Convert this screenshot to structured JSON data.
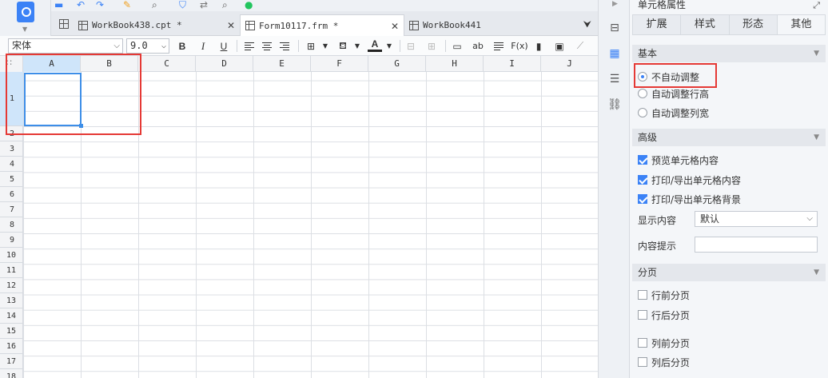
{
  "tabs": [
    {
      "label": "WorkBook438.cpt *",
      "active": false
    },
    {
      "label": "Form10117.frm *",
      "active": true
    },
    {
      "label": "WorkBook441",
      "active": false
    }
  ],
  "format_toolbar": {
    "font_name": "宋体",
    "font_size": "9.0",
    "bold_label": "B",
    "italic_label": "I",
    "underline_label": "U",
    "font_color_label": "A",
    "text_tool_label": "ab",
    "formula_label": "F(x)"
  },
  "sheet": {
    "columns": [
      "A",
      "B",
      "C",
      "D",
      "E",
      "F",
      "G",
      "H",
      "I",
      "J"
    ],
    "rows": [
      "1",
      "2",
      "3",
      "4",
      "5",
      "6",
      "7",
      "8",
      "9",
      "10",
      "11",
      "12",
      "13",
      "14",
      "15",
      "16",
      "17",
      "18"
    ],
    "selected_cell": "A1"
  },
  "panel": {
    "title": "单元格属性",
    "tabs": [
      "扩展",
      "样式",
      "形态",
      "其他"
    ],
    "active_tab": "其他",
    "basic": {
      "header": "基本",
      "options": [
        "不自动调整",
        "自动调整行高",
        "自动调整列宽"
      ],
      "selected": "不自动调整"
    },
    "advanced": {
      "header": "高级",
      "checks": [
        {
          "label": "预览单元格内容",
          "checked": true
        },
        {
          "label": "打印/导出单元格内容",
          "checked": true
        },
        {
          "label": "打印/导出单元格背景",
          "checked": true
        }
      ],
      "display_label": "显示内容",
      "display_value": "默认",
      "tip_label": "内容提示",
      "tip_value": ""
    },
    "pagination": {
      "header": "分页",
      "options": [
        {
          "label": "行前分页",
          "checked": false
        },
        {
          "label": "行后分页",
          "checked": false
        },
        {
          "label": "列前分页",
          "checked": false
        },
        {
          "label": "列后分页",
          "checked": false
        }
      ]
    }
  },
  "colors": {
    "accent": "#3b82f6",
    "highlight": "#e53935",
    "selection": "#cfe5fa"
  }
}
